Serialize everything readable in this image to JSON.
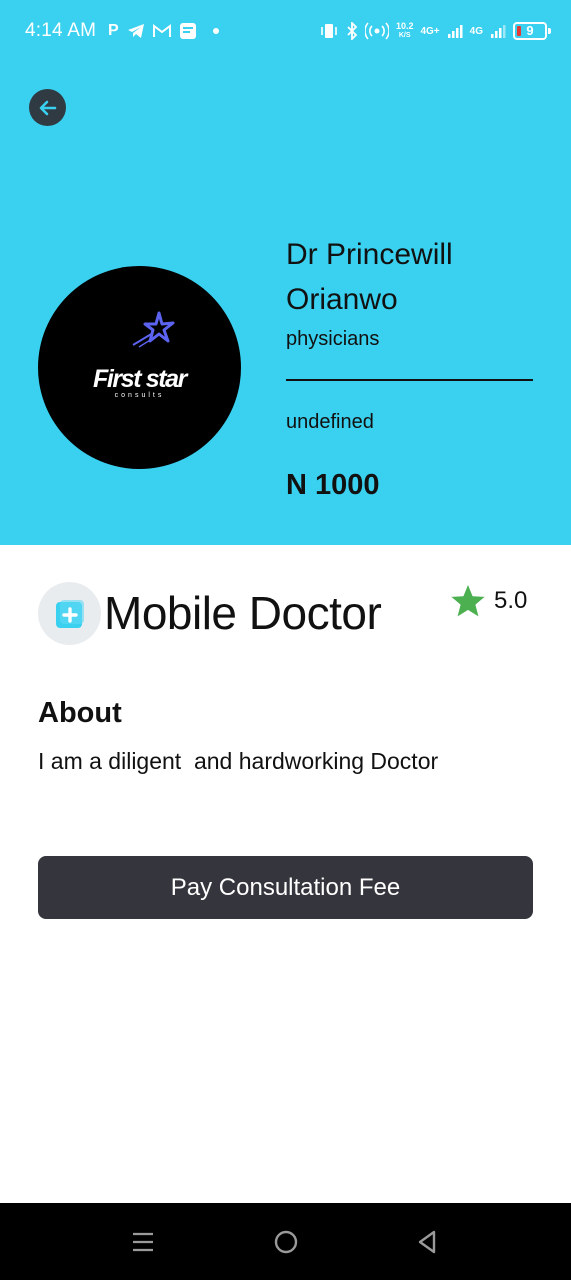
{
  "status_bar": {
    "time": "4:14 AM",
    "left_icons": [
      "P",
      "telegram-icon",
      "gmail-icon",
      "message-icon"
    ],
    "net_speed_value": "10.2",
    "net_speed_unit": "K/S",
    "signal_1": "4G+",
    "signal_2": "4G",
    "battery_level": "9"
  },
  "header": {
    "back_icon": "arrow-left-icon",
    "avatar_logo_text": "First star",
    "avatar_logo_sub": "consults",
    "doctor_name": "Dr Princewill Orianwo",
    "specialty": "physicians",
    "detail": "undefined",
    "price": "N 1000"
  },
  "app": {
    "title": "Mobile Doctor",
    "rating": "5.0",
    "star_color": "#4caf50"
  },
  "about": {
    "title": "About",
    "text": "I am a diligent  and hardworking Doctor"
  },
  "actions": {
    "pay_label": "Pay Consultation Fee"
  },
  "colors": {
    "header_bg": "#3ad0ef",
    "button_bg": "#35363d"
  },
  "nav": {
    "items": [
      "menu-icon",
      "home-icon",
      "back-triangle-icon"
    ]
  }
}
